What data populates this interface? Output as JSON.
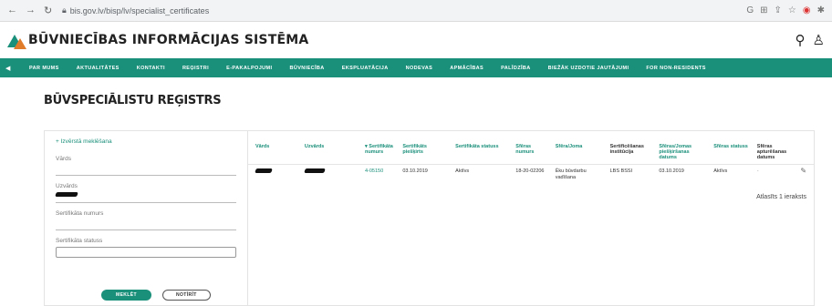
{
  "browser": {
    "url": "bis.gov.lv/bisp/lv/specialist_certificates"
  },
  "site": {
    "logo_text": "BŪVNIECĪBAS INFORMĀCIJAS SISTĒMA"
  },
  "nav": {
    "items": [
      "PAR MUMS",
      "AKTUALITĀTES",
      "KONTAKTI",
      "REĢISTRI",
      "E-PAKALPOJUMI",
      "BŪVNIECĪBA",
      "EKSPLUATĀCIJA",
      "NODEVAS",
      "APMĀCĪBAS",
      "PALĪDZĪBA",
      "BIEŽĀK UZDOTIE JAUTĀJUMI",
      "FOR NON-RESIDENTS"
    ]
  },
  "page": {
    "title": "BŪVSPECIĀLISTU REĢISTRS"
  },
  "filters": {
    "advanced_search": "+ Izvērstā meklēšana",
    "first_name_label": "Vārds",
    "last_name_label": "Uzvārds",
    "cert_number_label": "Sertifikāta numurs",
    "cert_status_label": "Sertifikāta statuss",
    "search_button": "MEKLĒT",
    "clear_button": "NOTĪRĪT"
  },
  "table": {
    "headers": {
      "first_name": "Vārds",
      "last_name": "Uzvārds",
      "cert_number": "▾ Sertifikāta numurs",
      "cert_issued": "Sertifikāts piešķirts",
      "cert_status": "Sertifikāta statuss",
      "sphere_number": "Sfēras numurs",
      "sphere": "Sfēra/Joma",
      "cert_institution": "Sertificēšanas institūcija",
      "sphere_granted": "Sfēras/Jomas piešķiršanas datums",
      "sphere_status": "Sfēras statuss",
      "sphere_suspended": "Sfēras apturēšanas datums"
    },
    "rows": [
      {
        "cert_number": "4-05150",
        "cert_issued": "03.10.2019",
        "cert_status": "Aktīvs",
        "sphere_number": "18-20-02206",
        "sphere": "Ēku būvdarbu vadīšana",
        "cert_institution": "LBS BSSI",
        "sphere_granted": "03.10.2019",
        "sphere_status": "Aktīvs",
        "sphere_suspended": "-"
      }
    ],
    "count_text": "Atlasīts 1 ieraksts"
  },
  "colors": {
    "brand": "#1a8f7a",
    "accent": "#e07b2a"
  }
}
